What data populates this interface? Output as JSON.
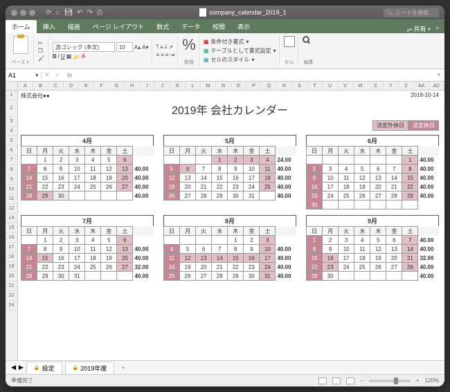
{
  "titlebar": {
    "filename": "company_calendar_2019_1",
    "search_placeholder": "シートを検索"
  },
  "tabs": {
    "items": [
      "ホーム",
      "挿入",
      "描画",
      "ページ レイアウト",
      "数式",
      "データ",
      "校閲",
      "表示"
    ],
    "share": "共有"
  },
  "ribbon": {
    "paste": "ペースト",
    "font_name": "游ゴシック (本文)",
    "font_size": "10",
    "number_label": "数値",
    "cond_fmt": "条件付き書式",
    "table_fmt": "テーブルとして書式設定",
    "cell_styles": "セルのスタイル",
    "cell_label": "セル",
    "edit_label": "編集"
  },
  "formula": {
    "cell": "A1",
    "fx": "fx"
  },
  "columns": [
    "A",
    "B",
    "C",
    "D",
    "E",
    "F",
    "G",
    "H",
    "I",
    "J",
    "K",
    "L",
    "M",
    "N",
    "O",
    "P",
    "Q",
    "R",
    "S",
    "T",
    "U",
    "V",
    "W",
    "X",
    "Y",
    "Z",
    "AA",
    "AC"
  ],
  "rows": [
    "1",
    "2",
    "3",
    "4",
    "5",
    "6",
    "7",
    "8",
    "9",
    "10",
    "11",
    "12",
    "14",
    "15",
    "16",
    "17",
    "18",
    "19",
    "20",
    "21",
    "22",
    "24"
  ],
  "sheet": {
    "company": "株式会社●●",
    "date": "2018-10-14",
    "title": "2019年 会社カレンダー",
    "legend": {
      "extra": "法定外休日",
      "legal": "法定休日"
    },
    "dow": [
      "日",
      "月",
      "火",
      "水",
      "木",
      "金",
      "土"
    ]
  },
  "chart_data": {
    "type": "table",
    "title": "2019年 会社カレンダー",
    "months": [
      {
        "name": "4月",
        "first_dow": 1,
        "days": 30,
        "holidays1": [
          7,
          14,
          21,
          28
        ],
        "holidays2": [
          6,
          13,
          20,
          27,
          29
        ],
        "grey": [
          30
        ],
        "hours": [
          "",
          "40.00",
          "40.00",
          "40.00",
          "40.00",
          ""
        ]
      },
      {
        "name": "5月",
        "first_dow": 3,
        "days": 31,
        "holidays1": [
          5,
          12,
          19,
          26
        ],
        "holidays2": [
          1,
          2,
          3,
          4,
          6,
          11,
          18,
          25
        ],
        "grey": [],
        "hours": [
          "24.00",
          "40.00",
          "40.00",
          "40.00",
          "40.00",
          ""
        ]
      },
      {
        "name": "6月",
        "first_dow": 6,
        "days": 30,
        "holidays1": [
          2,
          9,
          16,
          23,
          30
        ],
        "holidays2": [
          1,
          8,
          15,
          22,
          29
        ],
        "grey": [],
        "hours": [
          "40.00",
          "40.00",
          "40.00",
          "40.00",
          "40.00",
          ""
        ]
      },
      {
        "name": "7月",
        "first_dow": 1,
        "days": 31,
        "holidays1": [
          7,
          14,
          21,
          28
        ],
        "holidays2": [
          6,
          13,
          15,
          20,
          27
        ],
        "grey": [],
        "hours": [
          "",
          "40.00",
          "40.00",
          "32.00",
          "40.00",
          ""
        ]
      },
      {
        "name": "8月",
        "first_dow": 4,
        "days": 31,
        "holidays1": [
          4,
          11,
          18,
          25
        ],
        "holidays2": [
          3,
          10,
          12,
          13,
          14,
          15,
          16,
          17,
          24,
          31
        ],
        "grey": [],
        "hours": [
          "",
          "40.00",
          "40.00",
          "40.00",
          "40.00",
          ""
        ]
      },
      {
        "name": "9月",
        "first_dow": 0,
        "days": 30,
        "holidays1": [
          1,
          8,
          15,
          22,
          29
        ],
        "holidays2": [
          7,
          14,
          16,
          21,
          23,
          28
        ],
        "grey": [],
        "hours": [
          "40.00",
          "40.00",
          "32.00",
          "40.00",
          "40.00",
          ""
        ]
      }
    ]
  },
  "sheettabs": {
    "tab1": "設定",
    "tab2": "2019年度"
  },
  "status": {
    "ready": "準備完了",
    "zoom": "120%"
  }
}
